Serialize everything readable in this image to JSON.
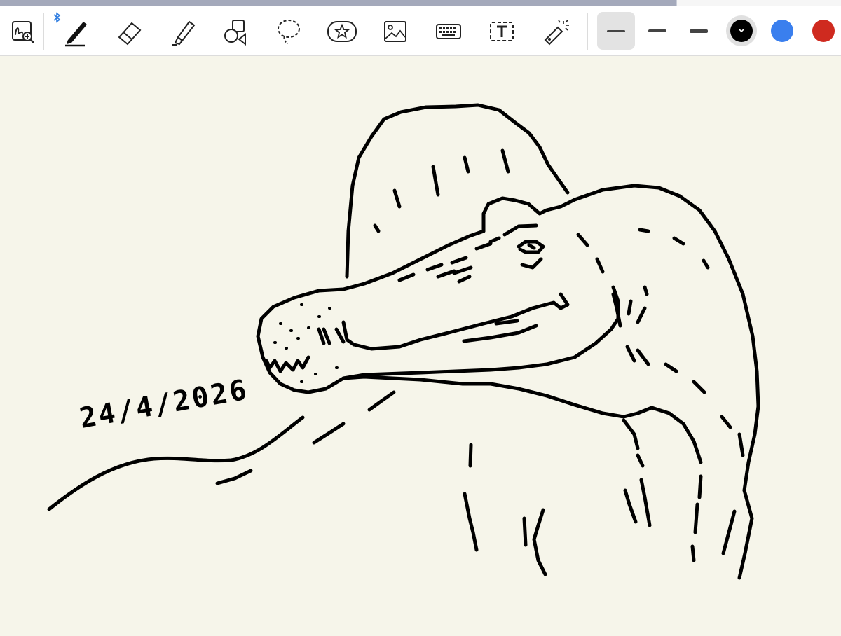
{
  "tab_strip": {
    "tabs": [
      "",
      "",
      "",
      "",
      ""
    ]
  },
  "toolbar": {
    "tools": [
      {
        "name": "zoom-window-icon"
      },
      {
        "name": "pen-icon",
        "selected": true
      },
      {
        "name": "eraser-icon"
      },
      {
        "name": "highlighter-icon"
      },
      {
        "name": "shapes-icon"
      },
      {
        "name": "lasso-icon"
      },
      {
        "name": "sticker-icon"
      },
      {
        "name": "image-icon"
      },
      {
        "name": "keyboard-icon"
      },
      {
        "name": "text-box-icon"
      },
      {
        "name": "laser-pointer-icon"
      }
    ],
    "bluetooth_icon": "bluetooth-icon",
    "stroke_widths": [
      {
        "name": "thin",
        "selected": true
      },
      {
        "name": "medium",
        "selected": false
      },
      {
        "name": "thick",
        "selected": false
      }
    ],
    "colors": [
      {
        "name": "black",
        "hex": "#000000",
        "selected": true
      },
      {
        "name": "blue",
        "hex": "#3a7fee",
        "selected": false
      },
      {
        "name": "red",
        "hex": "#cf2a1f",
        "selected": false
      }
    ]
  },
  "canvas": {
    "background": "#f6f5ea",
    "ink_color": "#000000",
    "handwritten_date": "24/4/2026",
    "drawing": "spinosaurus-sketch"
  }
}
